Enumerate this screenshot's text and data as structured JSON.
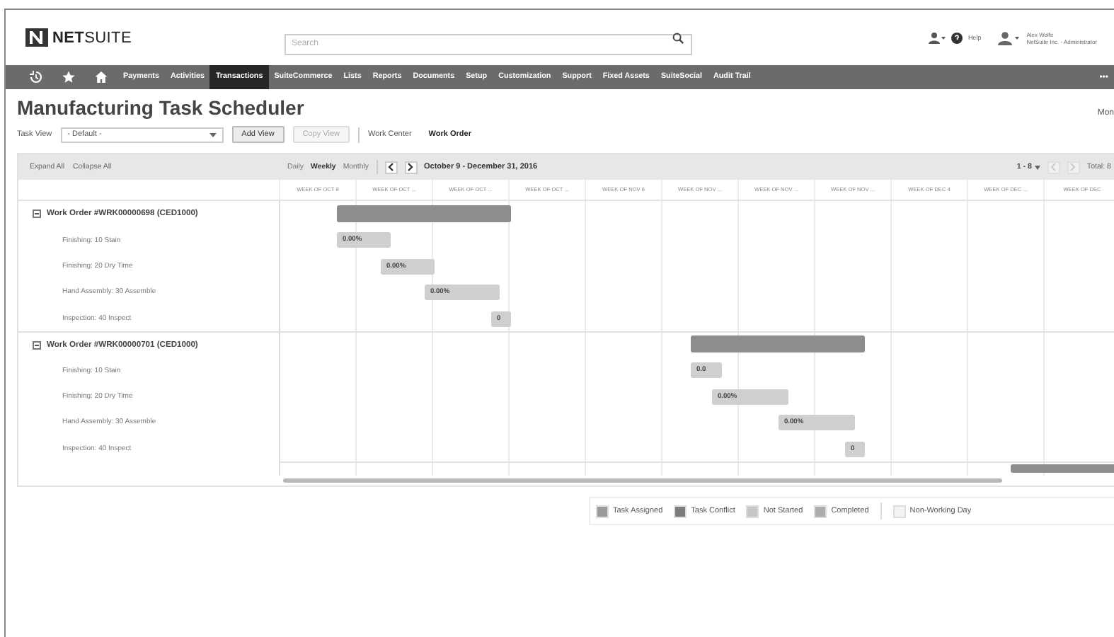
{
  "header": {
    "logo": "**NET**SUITE",
    "search": {
      "placeholder": "Search"
    },
    "help": "Help",
    "user": {
      "name": "Alex Wolfe",
      "role": "NetSuite Inc. - Administrator"
    }
  },
  "nav": {
    "items": [
      {
        "label": "Payments",
        "selected": false
      },
      {
        "label": "Activities",
        "selected": false
      },
      {
        "label": "Transactions",
        "selected": true
      },
      {
        "label": "SuiteCommerce",
        "selected": false
      },
      {
        "label": "Lists",
        "selected": false
      },
      {
        "label": "Reports",
        "selected": false
      },
      {
        "label": "Documents",
        "selected": false
      },
      {
        "label": "Setup",
        "selected": false
      },
      {
        "label": "Customization",
        "selected": false
      },
      {
        "label": "Support",
        "selected": false
      },
      {
        "label": "Fixed Assets",
        "selected": false
      },
      {
        "label": "SuiteSocial",
        "selected": false
      },
      {
        "label": "Audit Trail",
        "selected": false
      }
    ],
    "more": "•••"
  },
  "page": {
    "title": "Manufacturing Task Scheduler",
    "corner": "Mon"
  },
  "controls": {
    "task_view_label": "Task View",
    "task_view": "- Default -",
    "buttons": [
      {
        "label": "Add View",
        "disabled": false
      },
      {
        "label": "Copy View",
        "disabled": true
      }
    ],
    "tabs": [
      {
        "label": "Work Center",
        "selected": false
      },
      {
        "label": "Work Order",
        "selected": true
      }
    ]
  },
  "toolbar": {
    "links": [
      "Expand All",
      "Collapse All"
    ],
    "scales": [
      {
        "label": "Daily",
        "selected": false
      },
      {
        "label": "Weekly",
        "selected": true
      },
      {
        "label": "Monthly",
        "selected": false
      }
    ],
    "range": "October 9 - December 31, 2016",
    "page": "1 - 8",
    "pager_disabled": true,
    "total": "Total: 8"
  },
  "weeks": [
    "WEEK OF OCT 9",
    "WEEK OF OCT ...",
    "WEEK OF OCT ...",
    "WEEK OF OCT ...",
    "WEEK OF NOV 6",
    "WEEK OF NOV ...",
    "WEEK OF NOV ...",
    "WEEK OF NOV ...",
    "WEEK OF DEC 4",
    "WEEK OF DEC ...",
    "WEEK OF DEC"
  ],
  "rows": [
    {
      "kind": "order",
      "label": "Work Order #WRK00000698 (CED1000)",
      "expanded": true
    },
    {
      "kind": "task",
      "label": "Finishing: 10 Stain",
      "bar": "0.00%"
    },
    {
      "kind": "task",
      "label": "Finishing: 20 Dry Time",
      "bar": "0.00%"
    },
    {
      "kind": "task",
      "label": "Hand Assembly: 30 Assemble",
      "bar": "0.00%"
    },
    {
      "kind": "task",
      "label": "Inspection: 40 Inspect",
      "bar": "0"
    },
    {
      "kind": "order",
      "label": "Work Order #WRK00000701 (CED1000)",
      "expanded": true
    },
    {
      "kind": "task",
      "label": "Finishing: 10 Stain",
      "bar": "0.0"
    },
    {
      "kind": "task",
      "label": "Finishing: 20 Dry Time",
      "bar": "0.00%"
    },
    {
      "kind": "task",
      "label": "Hand Assembly: 30 Assemble",
      "bar": "0.00%"
    },
    {
      "kind": "task",
      "label": "Inspection: 40 Inspect",
      "bar": "0"
    }
  ],
  "legend": [
    {
      "label": "Task Assigned",
      "color": "#9a9a9a"
    },
    {
      "label": "Task Conflict",
      "color": "#7c7c7c"
    },
    {
      "label": "Not Started",
      "color": "#c6c6c6"
    },
    {
      "label": "Completed",
      "color": "#acacac"
    },
    {
      "label": "Non-Working Day",
      "color": "#f3f3f3"
    }
  ]
}
